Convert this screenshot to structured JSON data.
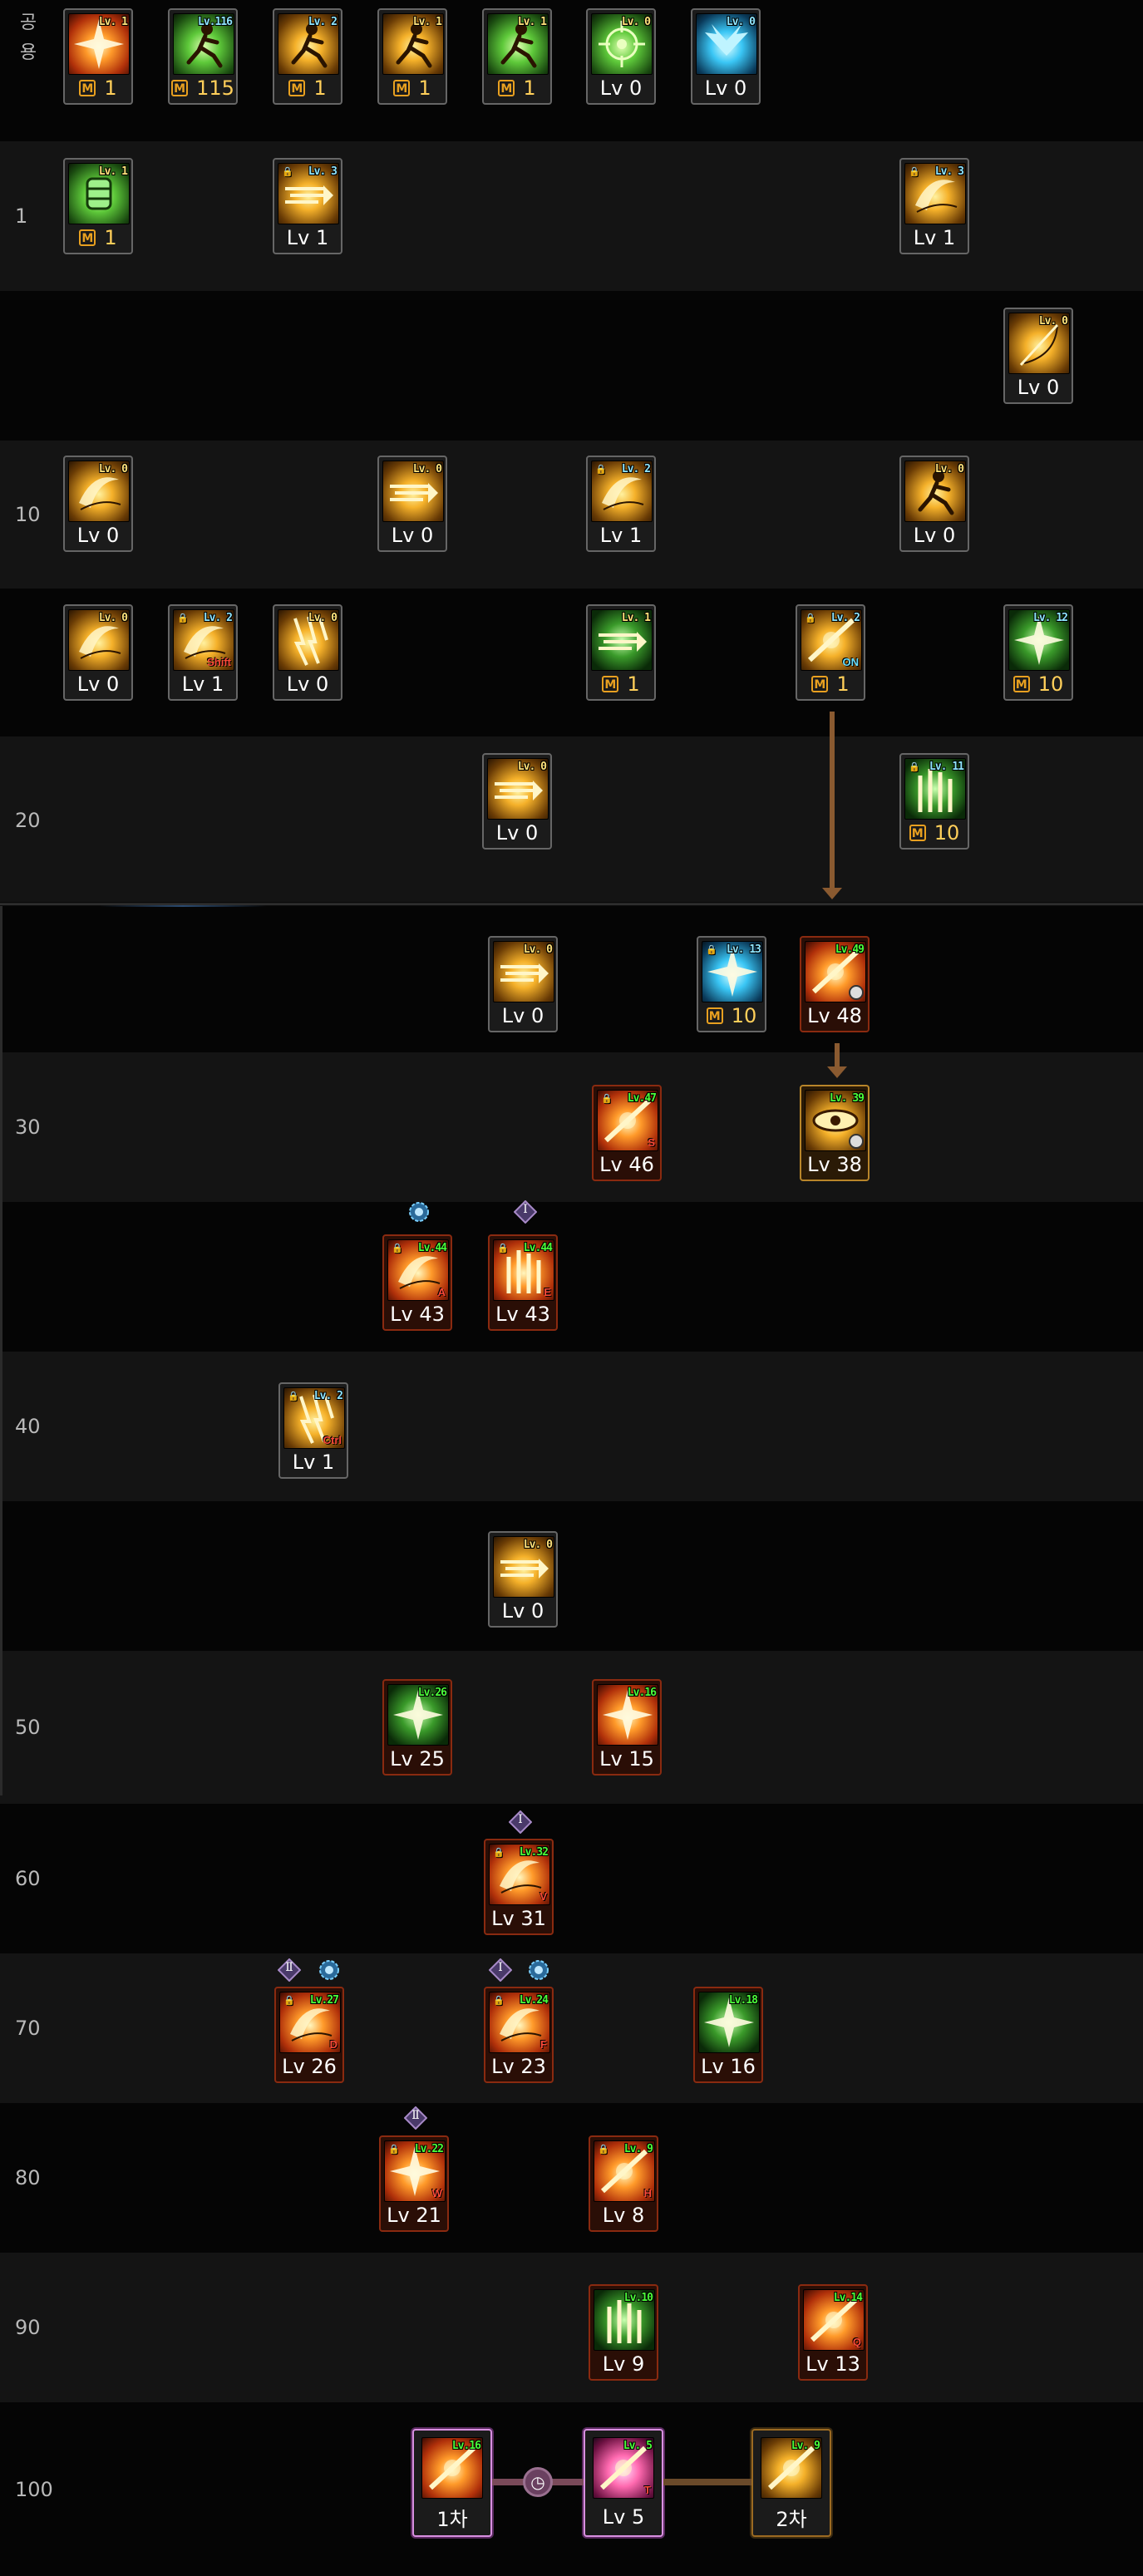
{
  "rows": [
    {
      "label": "공용",
      "vertical": true
    },
    {
      "label": "1"
    },
    {
      "label": ""
    },
    {
      "label": "10"
    },
    {
      "label": ""
    },
    {
      "label": "20"
    },
    {
      "label": ""
    },
    {
      "label": "30"
    },
    {
      "label": ""
    },
    {
      "label": "40"
    },
    {
      "label": ""
    },
    {
      "label": "50"
    },
    {
      "label": "60"
    },
    {
      "label": "70"
    },
    {
      "label": "80"
    },
    {
      "label": "90"
    },
    {
      "label": "100"
    }
  ],
  "skills": [
    {
      "id": "common-1",
      "icon": "fire-burst-icon",
      "grad": "g-fire",
      "tag": "Lv. 1",
      "tagc": "y",
      "m": true,
      "bottom": "1"
    },
    {
      "id": "common-2",
      "icon": "running-figure-icon",
      "grad": "g-green",
      "tag": "Lv.116",
      "tagc": "c",
      "m": true,
      "bottom": "115"
    },
    {
      "id": "common-3",
      "icon": "flex-figure-icon",
      "grad": "g-gold",
      "tag": "Lv. 2",
      "tagc": "c",
      "m": true,
      "bottom": "1"
    },
    {
      "id": "common-4",
      "icon": "crouch-figure-icon",
      "grad": "g-gold",
      "tag": "Lv. 1",
      "tagc": "y",
      "m": true,
      "bottom": "1"
    },
    {
      "id": "common-5",
      "icon": "sprint-figure-icon",
      "grad": "g-green",
      "tag": "Lv. 1",
      "tagc": "y",
      "m": true,
      "bottom": "1"
    },
    {
      "id": "common-6",
      "icon": "crosshair-icon",
      "grad": "g-green",
      "tag": "Lv. 0",
      "tagc": "y",
      "m": false,
      "bottom": "Lv 0"
    },
    {
      "id": "common-7",
      "icon": "wings-icon",
      "grad": "g-blue",
      "tag": "Lv. 0",
      "tagc": "c",
      "m": false,
      "bottom": "Lv 0"
    },
    {
      "id": "lv1-1",
      "icon": "gauntlet-icon",
      "grad": "g-green",
      "tag": "Lv. 1",
      "tagc": "y",
      "m": true,
      "bottom": "1"
    },
    {
      "id": "lv1-2",
      "icon": "dash-icon",
      "grad": "g-gold",
      "tag": "Lv. 3",
      "tagc": "c",
      "lock": true,
      "m": false,
      "bottom": "Lv 1"
    },
    {
      "id": "lv1-3",
      "icon": "slash-arc-icon",
      "grad": "g-gold",
      "tag": "Lv. 3",
      "tagc": "c",
      "lock": true,
      "m": false,
      "bottom": "Lv 1"
    },
    {
      "id": "r3-1",
      "icon": "bow-icon",
      "grad": "g-gold",
      "tag": "Lv. 0",
      "tagc": "y",
      "m": false,
      "bottom": "Lv 0"
    },
    {
      "id": "r4-1",
      "icon": "crescent-icon",
      "grad": "g-gold",
      "tag": "Lv. 0",
      "tagc": "y",
      "m": false,
      "bottom": "Lv 0"
    },
    {
      "id": "r4-2",
      "icon": "thrust-icon",
      "grad": "g-gold",
      "tag": "Lv. 0",
      "tagc": "y",
      "m": false,
      "bottom": "Lv 0"
    },
    {
      "id": "r4-3",
      "icon": "eye-slash-icon",
      "grad": "g-gold",
      "tag": "Lv. 2",
      "tagc": "c",
      "lock": true,
      "m": false,
      "bottom": "Lv 1"
    },
    {
      "id": "r4-4",
      "icon": "kick-icon",
      "grad": "g-gold",
      "tag": "Lv. 0",
      "tagc": "y",
      "m": false,
      "bottom": "Lv 0"
    },
    {
      "id": "r5-1",
      "icon": "swirl-icon",
      "grad": "g-gold",
      "tag": "Lv. 0",
      "tagc": "y",
      "m": false,
      "bottom": "Lv 0"
    },
    {
      "id": "r5-2",
      "icon": "swirl-shift-icon",
      "grad": "g-gold",
      "tag": "Lv. 2",
      "tagc": "c",
      "lock": true,
      "key": "Shift",
      "m": false,
      "bottom": "Lv 1"
    },
    {
      "id": "r5-3",
      "icon": "lightning-icon",
      "grad": "g-gold",
      "tag": "Lv. 0",
      "tagc": "y",
      "m": false,
      "bottom": "Lv 0"
    },
    {
      "id": "r5-4",
      "icon": "green-streaks-icon",
      "grad": "g-gn",
      "tag": "Lv. 1",
      "tagc": "y",
      "m": true,
      "bottom": "1"
    },
    {
      "id": "r5-5",
      "icon": "strike-on-icon",
      "grad": "g-gold",
      "tag": "Lv. 2",
      "tagc": "c",
      "lock": true,
      "key": "ON",
      "keyc": "cyan",
      "m": true,
      "bottom": "1"
    },
    {
      "id": "r5-6",
      "icon": "leaf-burst-icon",
      "grad": "g-gn",
      "tag": "Lv. 12",
      "tagc": "c",
      "m": true,
      "bottom": "10"
    },
    {
      "id": "r6-1",
      "icon": "speed-lines-icon",
      "grad": "g-gold",
      "tag": "Lv. 0",
      "tagc": "y",
      "m": false,
      "bottom": "Lv 0"
    },
    {
      "id": "r6-2",
      "icon": "green-pillars-icon",
      "grad": "g-gn",
      "tag": "Lv. 11",
      "tagc": "c",
      "lock": true,
      "m": true,
      "bottom": "10"
    },
    {
      "id": "r7-1",
      "icon": "double-dash-icon",
      "grad": "g-gold",
      "tag": "Lv. 0",
      "tagc": "y",
      "m": false,
      "bottom": "Lv 0"
    },
    {
      "id": "r7-2",
      "icon": "blue-blast-icon",
      "grad": "g-blue",
      "tag": "Lv. 13",
      "tagc": "c",
      "lock": true,
      "m": true,
      "bottom": "10"
    },
    {
      "id": "r7-3",
      "icon": "fire-clock-icon",
      "grad": "g-fire",
      "tag": "Lv.49",
      "tagc": "g",
      "clock": true,
      "m": false,
      "bottom": "Lv 48",
      "frame": "red"
    },
    {
      "id": "r8-1",
      "icon": "blade-s-icon",
      "grad": "g-fire",
      "tag": "Lv.47",
      "tagc": "g",
      "lock": true,
      "key": "S",
      "m": false,
      "bottom": "Lv 46",
      "frame": "red"
    },
    {
      "id": "r8-2",
      "icon": "eye-clock-icon",
      "grad": "g-gold",
      "tag": "Lv. 39",
      "tagc": "g",
      "clock": true,
      "m": false,
      "bottom": "Lv 38",
      "frame": "orange"
    },
    {
      "id": "r9-1",
      "icon": "swirl-a-icon",
      "grad": "g-fire",
      "tag": "Lv.44",
      "tagc": "g",
      "lock": true,
      "key": "A",
      "m": false,
      "bottom": "Lv 43",
      "frame": "red"
    },
    {
      "id": "r9-2",
      "icon": "pillars-e-icon",
      "grad": "g-fire",
      "tag": "Lv.44",
      "tagc": "g",
      "lock": true,
      "key": "E",
      "m": false,
      "bottom": "Lv 43",
      "frame": "red"
    },
    {
      "id": "r10-1",
      "icon": "claw-ctrl-icon",
      "grad": "g-gold",
      "tag": "Lv. 2",
      "tagc": "c",
      "lock": true,
      "key": "Ctrl",
      "m": false,
      "bottom": "Lv 1"
    },
    {
      "id": "r11-1",
      "icon": "wind-lines-icon",
      "grad": "g-gold",
      "tag": "Lv. 0",
      "tagc": "y",
      "m": false,
      "bottom": "Lv 0"
    },
    {
      "id": "r12-1",
      "icon": "green-spark-icon",
      "grad": "g-gn",
      "tag": "Lv.26",
      "tagc": "g",
      "m": false,
      "bottom": "Lv 25",
      "frame": "red"
    },
    {
      "id": "r12-2",
      "icon": "fire-star-icon",
      "grad": "g-fire",
      "tag": "Lv.16",
      "tagc": "g",
      "m": false,
      "bottom": "Lv 15",
      "frame": "red"
    },
    {
      "id": "r13-1",
      "icon": "swirl-v-icon",
      "grad": "g-fire",
      "tag": "Lv.32",
      "tagc": "g",
      "lock": true,
      "key": "V",
      "m": false,
      "bottom": "Lv 31",
      "frame": "red"
    },
    {
      "id": "r14-1",
      "icon": "swing-d-icon",
      "grad": "g-fire",
      "tag": "Lv.27",
      "tagc": "g",
      "lock": true,
      "key": "D",
      "m": false,
      "bottom": "Lv 26",
      "frame": "red"
    },
    {
      "id": "r14-2",
      "icon": "crescent-f-icon",
      "grad": "g-fire",
      "tag": "Lv.24",
      "tagc": "g",
      "lock": true,
      "key": "F",
      "m": false,
      "bottom": "Lv 23",
      "frame": "red"
    },
    {
      "id": "r14-3",
      "icon": "green-aura-icon",
      "grad": "g-gn",
      "tag": "Lv.18",
      "tagc": "g",
      "m": false,
      "bottom": "Lv 16",
      "frame": "red"
    },
    {
      "id": "r15-1",
      "icon": "flare-w-icon",
      "grad": "g-fire",
      "tag": "Lv.22",
      "tagc": "g",
      "lock": true,
      "key": "W",
      "m": false,
      "bottom": "Lv 21",
      "frame": "red"
    },
    {
      "id": "r15-2",
      "icon": "spin-h-icon",
      "grad": "g-fire",
      "tag": "Lv. 9",
      "tagc": "g",
      "lock": true,
      "key": "H",
      "m": false,
      "bottom": "Lv 8",
      "frame": "red"
    },
    {
      "id": "r16-1",
      "icon": "green-rise-icon",
      "grad": "g-gn",
      "tag": "Lv.10",
      "tagc": "g",
      "m": false,
      "bottom": "Lv 9",
      "frame": "red"
    },
    {
      "id": "r16-2",
      "icon": "flame-q-icon",
      "grad": "g-fire",
      "tag": "Lv.14",
      "tagc": "g",
      "key": "Q",
      "m": false,
      "bottom": "Lv 13",
      "frame": "red"
    },
    {
      "id": "r17-1",
      "icon": "awaken-fire-icon",
      "grad": "g-fire",
      "tag": "Lv.16",
      "tagc": "g",
      "m": false,
      "bottom": "1차",
      "frame": "purple"
    },
    {
      "id": "r17-2",
      "icon": "awaken-pink-icon",
      "grad": "g-pink",
      "tag": "Lv. 5",
      "tagc": "g",
      "key": "T",
      "m": false,
      "bottom": "Lv 5",
      "frame": "purple"
    },
    {
      "id": "r17-3",
      "icon": "awaken-gold-icon",
      "grad": "g-gold",
      "tag": "Lv. 9",
      "tagc": "g",
      "m": false,
      "bottom": "2차",
      "frame": "gold"
    }
  ],
  "badges": {
    "roman1": "Ⅰ",
    "roman2": "Ⅱ"
  },
  "colors": {
    "m_tag": "#e8a020",
    "lv_green": "#4bff3a",
    "lv_cyan": "#8fe6ff",
    "lv_yellow": "#ffe27a",
    "key_red": "#ff4a3a"
  }
}
